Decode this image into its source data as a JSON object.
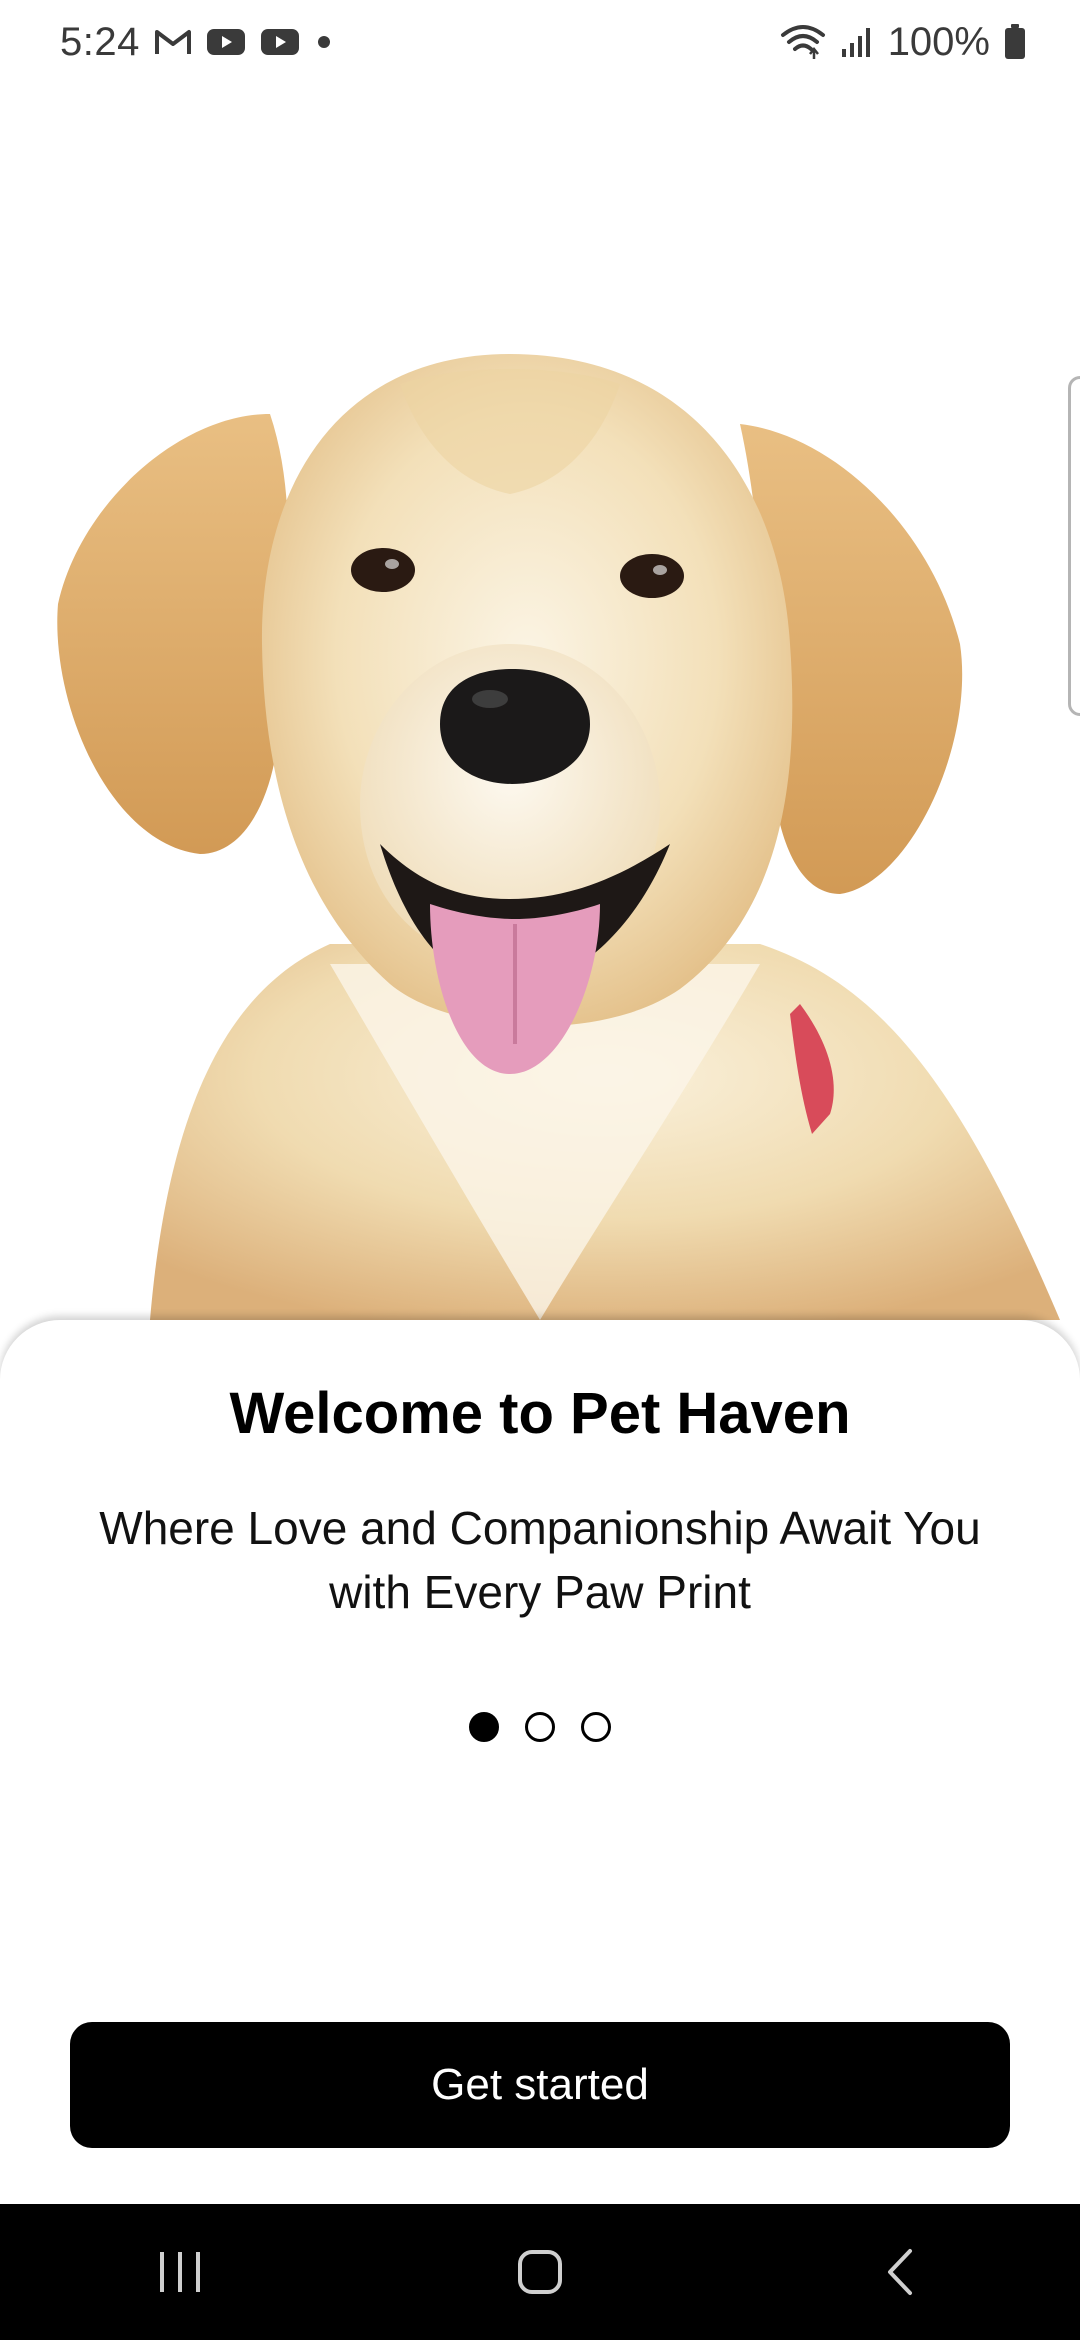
{
  "status_bar": {
    "time": "5:24",
    "notification_icons": [
      "gmail-icon",
      "youtube-icon",
      "youtube-icon",
      "dot-icon"
    ],
    "battery": "100%"
  },
  "hero": {
    "subject": "golden retriever dog"
  },
  "onboarding": {
    "title": "Welcome to Pet Haven",
    "subtitle": "Where Love and Companionship Await You with Every Paw Print",
    "pager": {
      "total": 3,
      "active": 1
    },
    "cta_label": "Get started"
  },
  "nav_bar": {
    "buttons": [
      "recent-apps-icon",
      "home-icon",
      "back-icon"
    ]
  },
  "colors": {
    "primary": "#000000",
    "background": "#ffffff",
    "dog_fur_light": "#f3dfb6",
    "dog_fur_dark": "#d9a663",
    "tongue": "#e59cbc",
    "collar": "#d84b5a"
  }
}
